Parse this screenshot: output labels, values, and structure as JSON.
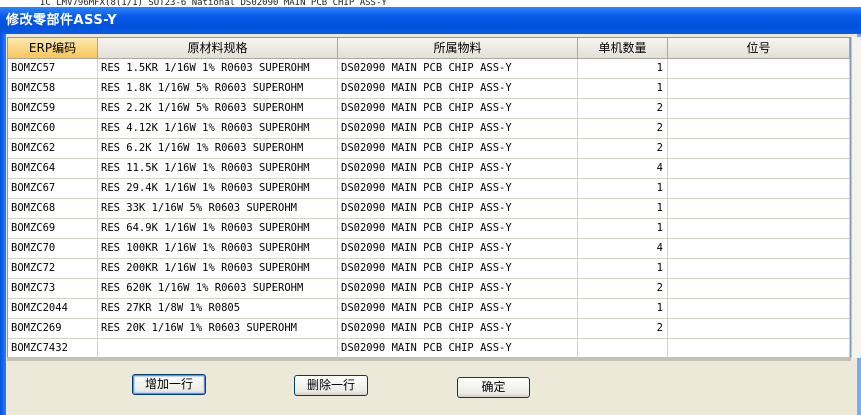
{
  "background_strip": "IC LMV796MFX(8(1/1) SOT23-6 National  DS02090 MAIN PCB CHIP ASS-Y",
  "window": {
    "title": "修改零部件ASS-Y"
  },
  "table": {
    "headers": [
      "ERP编码",
      "原材料规格",
      "所属物料",
      "单机数量",
      "位号"
    ],
    "rows": [
      {
        "erp": "BOMZC57",
        "spec": "RES 1.5KR 1/16W 1% R0603 SUPEROHM",
        "parent": "DS02090 MAIN PCB CHIP ASS-Y",
        "qty": "1",
        "pos": ""
      },
      {
        "erp": "BOMZC58",
        "spec": "RES 1.8K 1/16W 5% R0603 SUPEROHM",
        "parent": "DS02090 MAIN PCB CHIP ASS-Y",
        "qty": "1",
        "pos": ""
      },
      {
        "erp": "BOMZC59",
        "spec": "RES 2.2K 1/16W 5% R0603 SUPEROHM",
        "parent": "DS02090 MAIN PCB CHIP ASS-Y",
        "qty": "2",
        "pos": ""
      },
      {
        "erp": "BOMZC60",
        "spec": "RES 4.12K 1/16W 1% R0603 SUPEROHM",
        "parent": "DS02090 MAIN PCB CHIP ASS-Y",
        "qty": "2",
        "pos": ""
      },
      {
        "erp": "BOMZC62",
        "spec": "RES 6.2K 1/16W 1% R0603 SUPEROHM",
        "parent": "DS02090 MAIN PCB CHIP ASS-Y",
        "qty": "2",
        "pos": ""
      },
      {
        "erp": "BOMZC64",
        "spec": "RES 11.5K 1/16W 1% R0603 SUPEROHM",
        "parent": "DS02090 MAIN PCB CHIP ASS-Y",
        "qty": "4",
        "pos": ""
      },
      {
        "erp": "BOMZC67",
        "spec": "RES 29.4K 1/16W 1% R0603 SUPEROHM",
        "parent": "DS02090 MAIN PCB CHIP ASS-Y",
        "qty": "1",
        "pos": ""
      },
      {
        "erp": "BOMZC68",
        "spec": "RES 33K 1/16W 5% R0603 SUPEROHM",
        "parent": "DS02090 MAIN PCB CHIP ASS-Y",
        "qty": "1",
        "pos": ""
      },
      {
        "erp": "BOMZC69",
        "spec": "RES 64.9K 1/16W 1% R0603 SUPEROHM",
        "parent": "DS02090 MAIN PCB CHIP ASS-Y",
        "qty": "1",
        "pos": ""
      },
      {
        "erp": "BOMZC70",
        "spec": "RES 100KR 1/16W 1% R0603 SUPEROHM",
        "parent": "DS02090 MAIN PCB CHIP ASS-Y",
        "qty": "4",
        "pos": ""
      },
      {
        "erp": "BOMZC72",
        "spec": "RES 200KR 1/16W 1% R0603 SUPEROHM",
        "parent": "DS02090 MAIN PCB CHIP ASS-Y",
        "qty": "1",
        "pos": ""
      },
      {
        "erp": "BOMZC73",
        "spec": "RES 620K 1/16W 1% R0603 SUPEROHM",
        "parent": "DS02090 MAIN PCB CHIP ASS-Y",
        "qty": "2",
        "pos": ""
      },
      {
        "erp": "BOMZC2044",
        "spec": "RES 27KR 1/8W 1% R0805",
        "parent": "DS02090 MAIN PCB CHIP ASS-Y",
        "qty": "1",
        "pos": ""
      },
      {
        "erp": "BOMZC269",
        "spec": "RES 20K 1/16W 1% R0603 SUPEROHM",
        "parent": "DS02090 MAIN PCB CHIP ASS-Y",
        "qty": "2",
        "pos": ""
      },
      {
        "erp": "BOMZC7432",
        "spec": "",
        "parent": "DS02090 MAIN PCB CHIP ASS-Y",
        "qty": "",
        "pos": ""
      }
    ]
  },
  "buttons": {
    "add_row": "增加一行",
    "delete_row": "删除一行",
    "ok": "确定"
  },
  "colors": {
    "titlebar": "#0a5ae8",
    "active_header": "#f6c659",
    "dialog_bg": "#ece9d8"
  }
}
